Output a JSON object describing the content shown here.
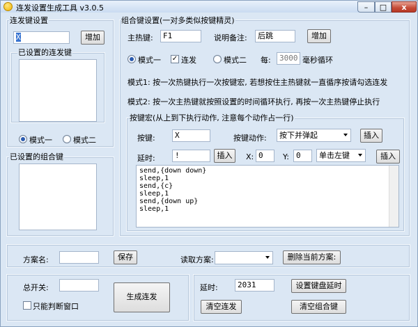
{
  "window": {
    "title": "连发设置生成工具  v3.0.5",
    "close": "x"
  },
  "left": {
    "group_title": "连发键设置",
    "key_input": "X",
    "add_label": "增加",
    "set_list_title": "已设置的连发键",
    "mode1": "模式一",
    "mode2": "模式二",
    "combo_list_title": "已设置的组合键"
  },
  "right": {
    "group_title": "组合键设置(一对多类似按键精灵)",
    "hotkey_label": "主热键:",
    "hotkey_value": "F1",
    "note_label": "说明备注:",
    "note_value": "后跳",
    "add_label": "增加",
    "mode1": "模式一",
    "repeat_label": "连发",
    "mode2": "模式二",
    "every_label": "每:",
    "interval_value": "3000",
    "ms_label": "毫秒循环",
    "desc1": "模式1: 按一次热键执行一次按键宏, 若想按住主热键就一直循序按请勾选连发",
    "desc2": "模式2: 按一次主热键就按照设置的时间循环执行, 再按一次主热键停止执行",
    "macro_title": "按键宏(从上到下执行动作, 注意每个动作占一行)",
    "key_label": "按键:",
    "key_value": "X",
    "action_label": "按键动作:",
    "action_value": "按下并弹起",
    "insert1": "插入",
    "delay_label": "延时:",
    "delay_value": "!",
    "insert2": "插入",
    "x_label": "X:",
    "x_value": "0",
    "y_label": "Y:",
    "y_value": "0",
    "click_value": "单击左键",
    "insert3": "插入",
    "script_lines": [
      "send,{down down}",
      "sleep,1",
      "send,{c}",
      "sleep,1",
      "send,{down up}",
      "sleep,1"
    ]
  },
  "scheme": {
    "name_label": "方案名:",
    "save_label": "保存",
    "read_label": "读取方案:",
    "delete_label": "删除当前方案:"
  },
  "bottom": {
    "switch_label": "总开关:",
    "only_window_label": "只能判断窗口",
    "generate_label": "生成连发",
    "delay_label": "延时:",
    "delay_value": "2031",
    "set_delay_label": "设置键盘延时",
    "clear_repeat_label": "清空连发",
    "clear_combo_label": "清空组合键"
  }
}
